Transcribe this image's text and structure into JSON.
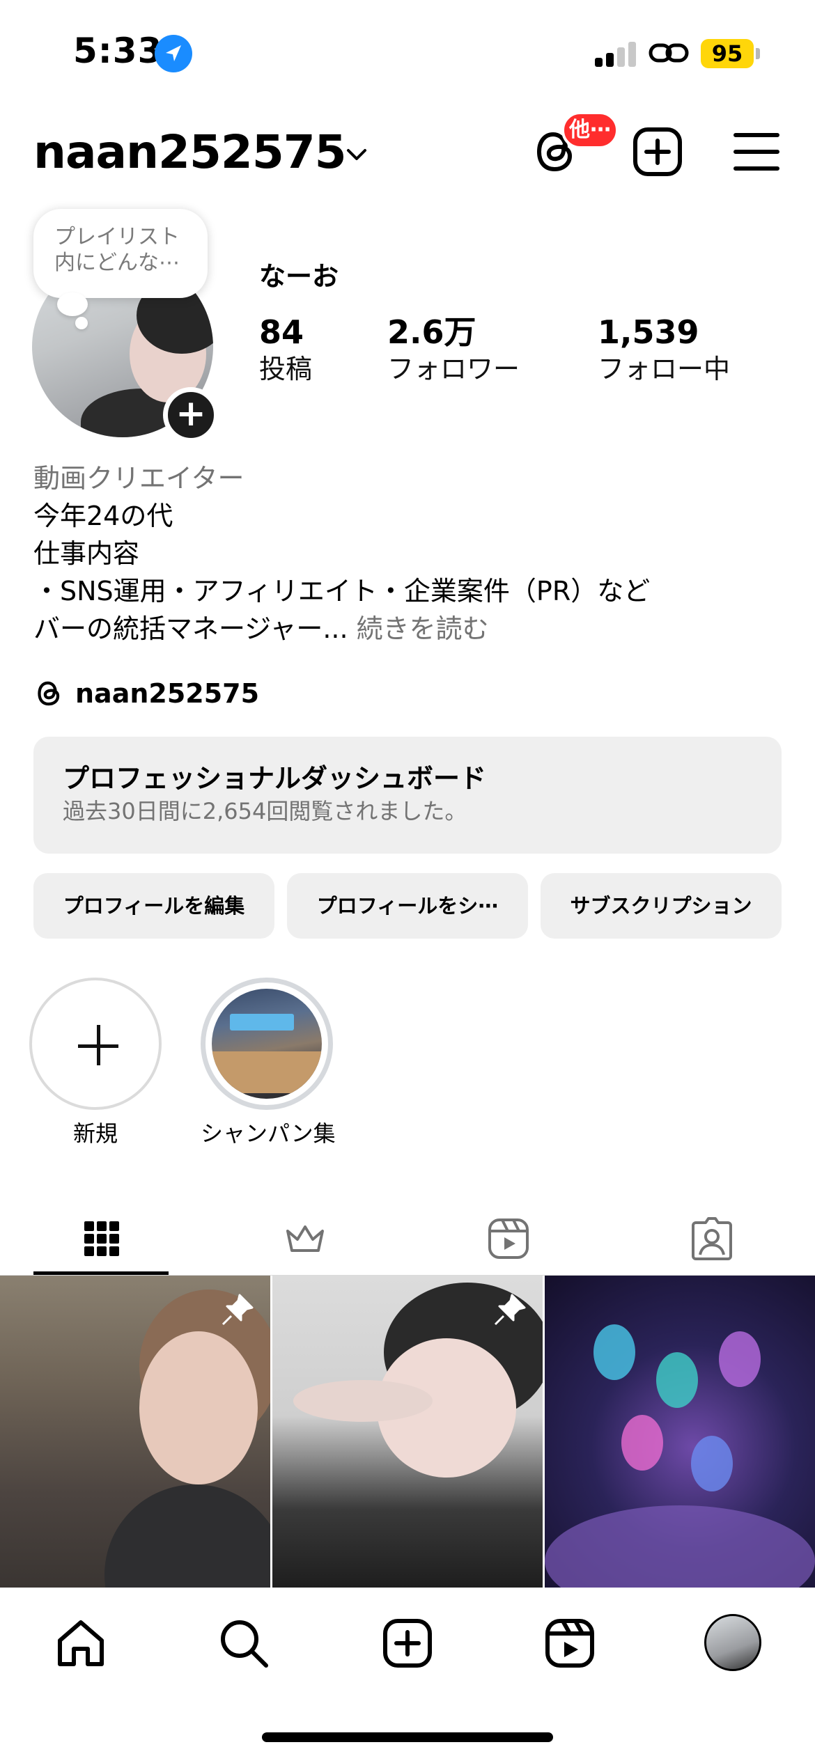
{
  "status_bar": {
    "time": "5:33",
    "battery": "95"
  },
  "header": {
    "username": "naan252575",
    "threads_badge": "他⋯",
    "icons": [
      "chevron-down-icon",
      "threads-icon",
      "create-icon",
      "menu-icon"
    ]
  },
  "profile": {
    "note": "プレイリスト内にどんな⋯",
    "display_name": "なーお",
    "stats": [
      {
        "value": "84",
        "label": "投稿"
      },
      {
        "value": "2.6万",
        "label": "フォロワー"
      },
      {
        "value": "1,539",
        "label": "フォロー中"
      }
    ],
    "bio": {
      "category": "動画クリエイター",
      "lines": [
        "今年24の代",
        "仕事内容",
        "・SNS運用・アフィリエイト・企業案件（PR）など"
      ],
      "last_line": "バーの統括マネージャー... ",
      "more": "続きを読む"
    },
    "threads_handle": "naan252575"
  },
  "dashboard": {
    "title": "プロフェッショナルダッシュボード",
    "subtitle": "過去30日間に2,654回閲覧されました。"
  },
  "buttons": {
    "edit": "プロフィールを編集",
    "share": "プロフィールをシ⋯",
    "subscription": "サブスクリプション"
  },
  "highlights": [
    {
      "label": "新規"
    },
    {
      "label": "シャンパン集"
    }
  ],
  "tabs": [
    "grid-icon",
    "crown-icon",
    "reels-icon",
    "tagged-icon"
  ],
  "bottom_nav": [
    "home-icon",
    "search-icon",
    "create-icon",
    "reels-icon",
    "profile-avatar"
  ],
  "colors": {
    "badge_red": "#ff2d2d",
    "battery_yellow": "#ffd60a",
    "secondary_text": "#737373",
    "button_bg": "#efefef",
    "location_blue": "#1a8cff"
  }
}
